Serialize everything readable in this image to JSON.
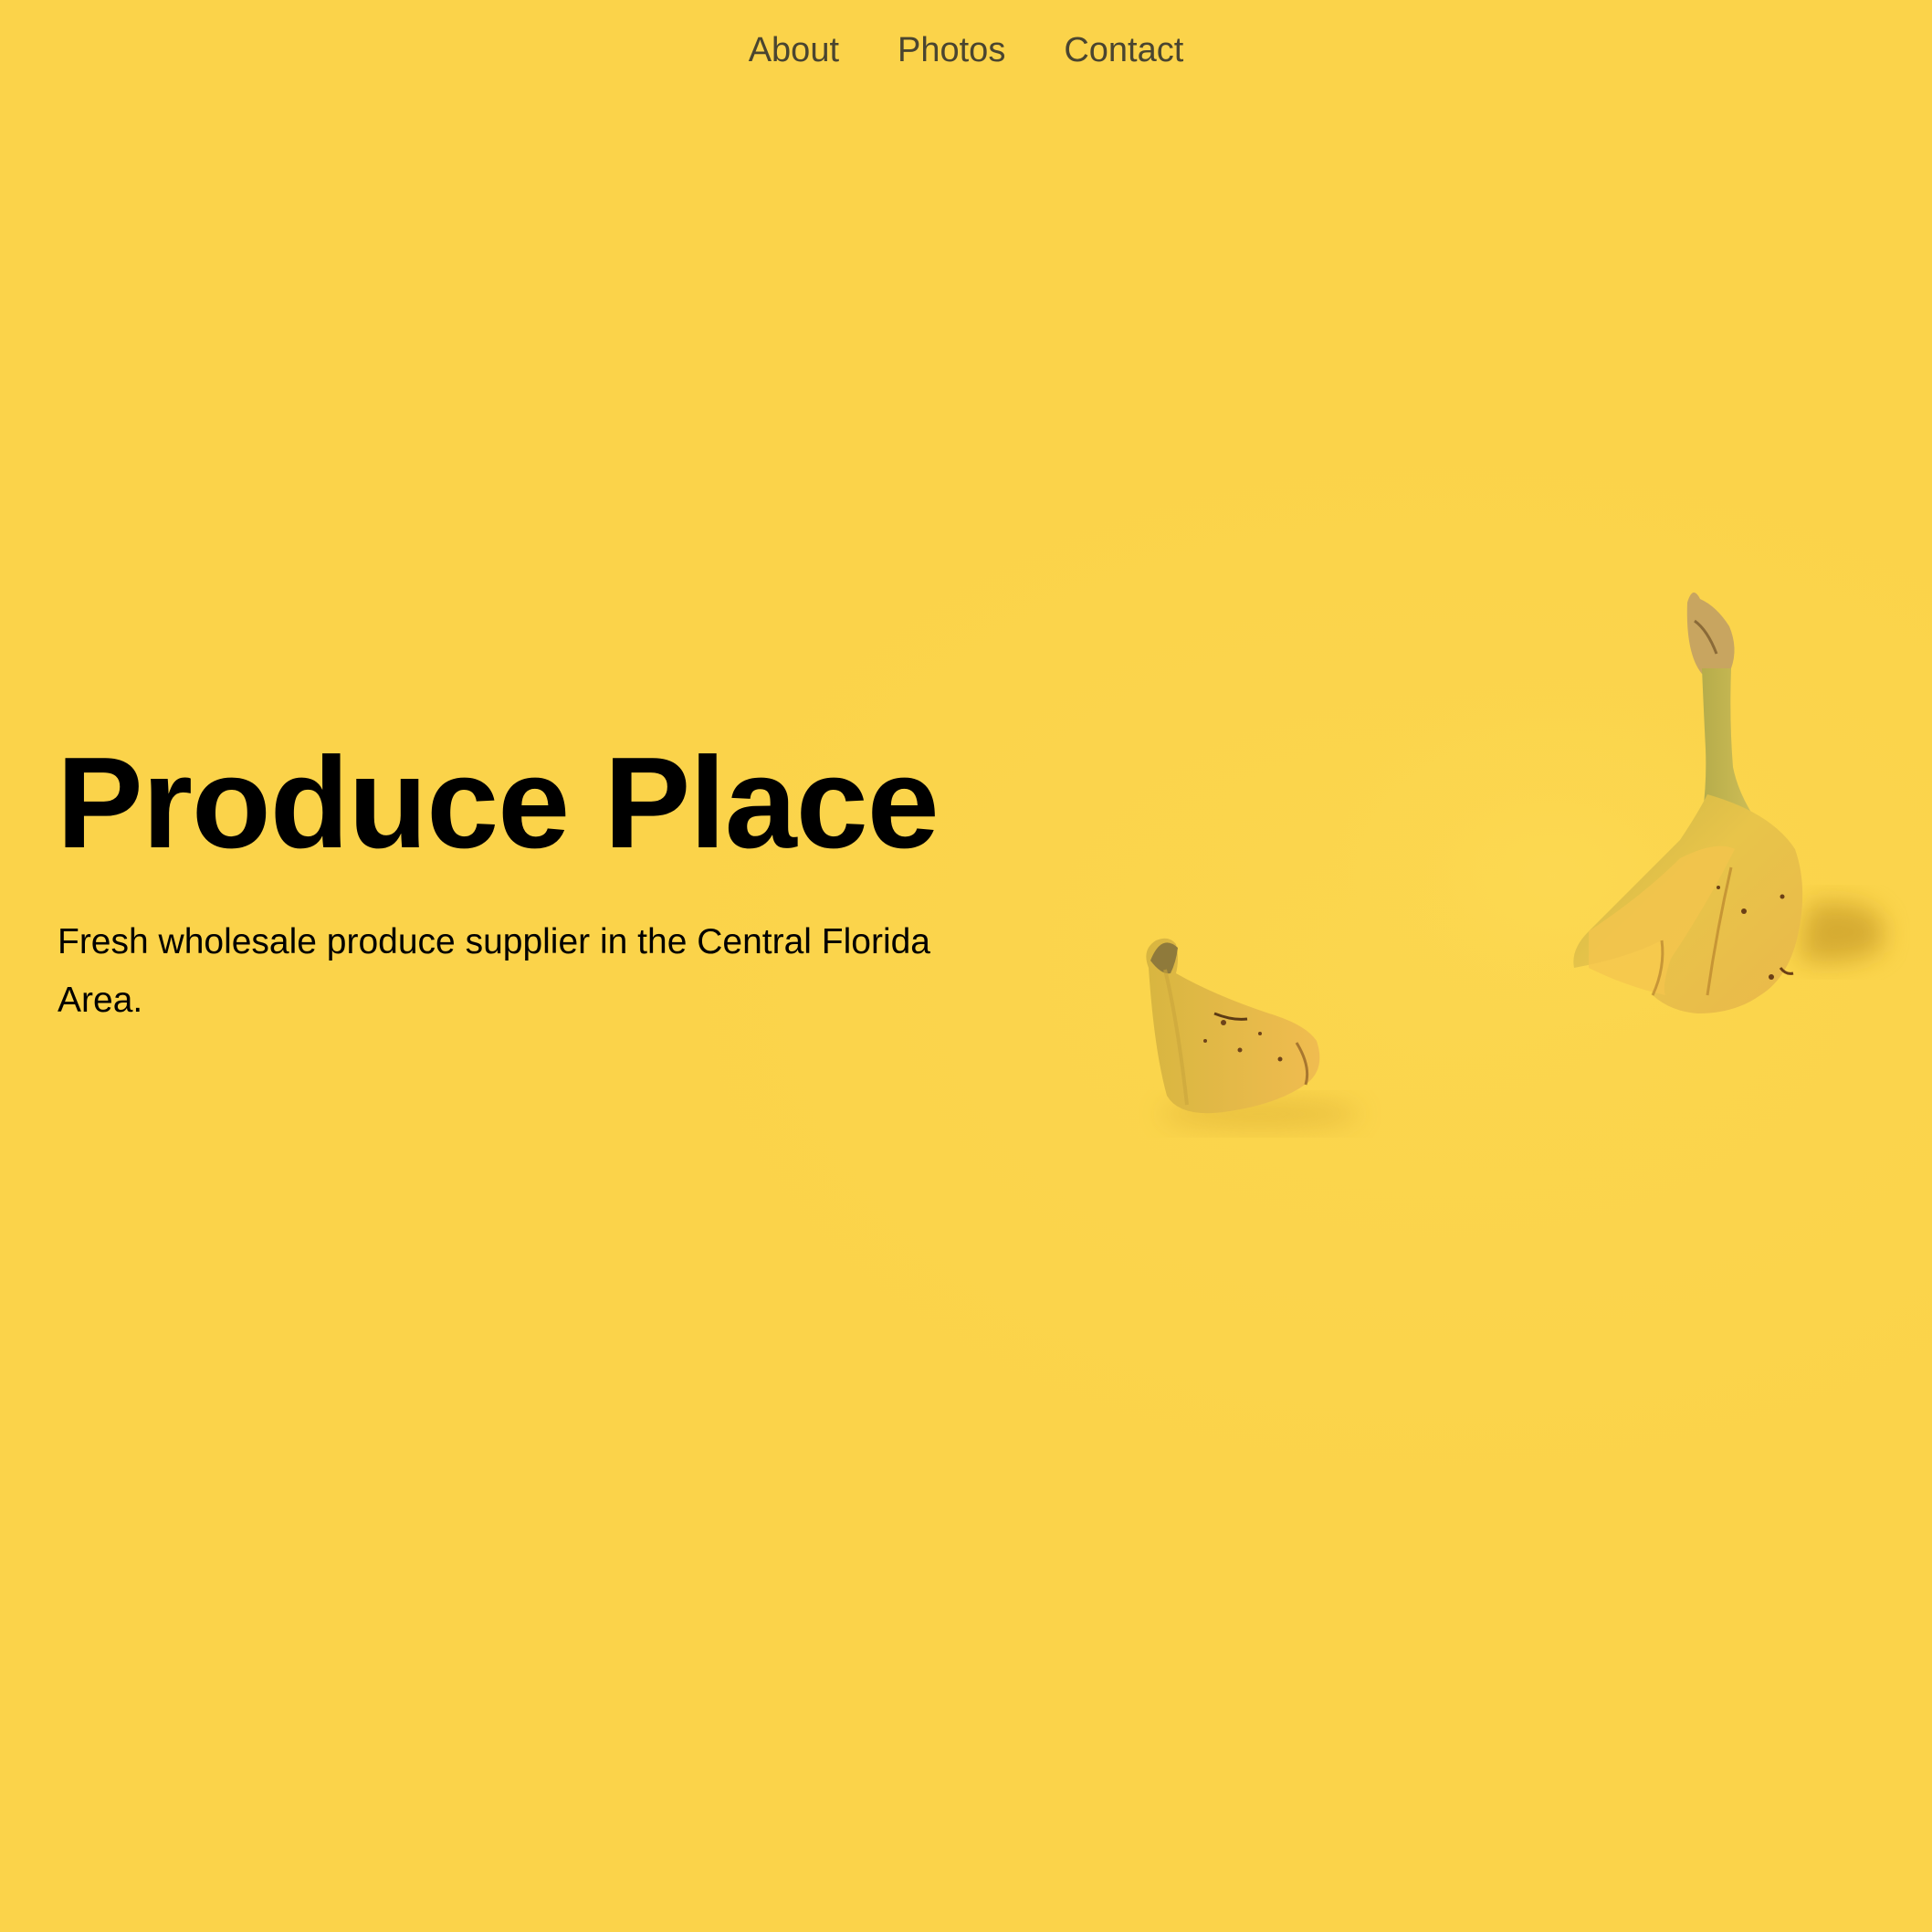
{
  "nav": {
    "items": [
      {
        "label": "About"
      },
      {
        "label": "Photos"
      },
      {
        "label": "Contact"
      }
    ]
  },
  "hero": {
    "title": "Produce Place",
    "subtitle": "Fresh wholesale produce supplier in the Central Florida Area."
  },
  "colors": {
    "background": "#fbd34a",
    "nav_text": "#4a4530",
    "text": "#000000"
  }
}
